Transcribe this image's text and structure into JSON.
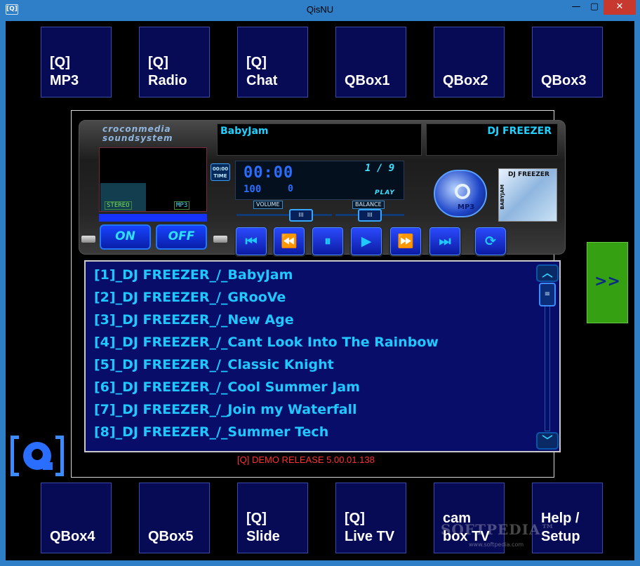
{
  "window": {
    "title": "QisNU",
    "icon_text": "[Q]",
    "minimize": "—",
    "maximize": "▢",
    "close": "✕"
  },
  "nav_top": [
    {
      "line1": "[Q]",
      "line2": "MP3"
    },
    {
      "line1": "[Q]",
      "line2": "Radio"
    },
    {
      "line1": "[Q]",
      "line2": "Chat"
    },
    {
      "line1": "",
      "line2": "QBox1"
    },
    {
      "line1": "",
      "line2": "QBox2"
    },
    {
      "line1": "",
      "line2": "QBox3"
    }
  ],
  "nav_bottom": [
    {
      "line1": "",
      "line2": "QBox4"
    },
    {
      "line1": "",
      "line2": "QBox5"
    },
    {
      "line1": "[Q]",
      "line2": "Slide"
    },
    {
      "line1": "[Q]",
      "line2": "Live TV"
    },
    {
      "line1": "cam",
      "line2": "box TV"
    },
    {
      "line1": "Help /",
      "line2": "Setup"
    }
  ],
  "player": {
    "brand_line1": "croconmedia",
    "brand_line2": "soundsystem",
    "song_title": "BabyJam",
    "artist": "DJ FREEZER",
    "time_badge_line1": "00:00",
    "time_badge_line2": "TIME",
    "time": "00:00",
    "track_count": "1 / 9",
    "volume_value": "100",
    "balance_value": "0",
    "state": "PLAY",
    "stereo_tag": "STEREO",
    "format_tag": "MP3",
    "volume_label": "VOLUME",
    "balance_label": "BALANCE",
    "knob_glyph": "III",
    "mp3_button_label": "MP3",
    "cover_title": "DJ FREEZER",
    "cover_side": "BABYJAM",
    "on_label": "ON",
    "off_label": "OFF",
    "buttons": {
      "first": "⏮",
      "rewind": "⏪",
      "pause": "⏸",
      "play": "▶",
      "forward": "⏩",
      "last": "⏭",
      "repeat": "⟳"
    }
  },
  "playlist": [
    "[1]_DJ FREEZER_/_BabyJam",
    "[2]_DJ FREEZER_/_GRooVe",
    "[3]_DJ FREEZER_/_New Age",
    "[4]_DJ FREEZER_/_Cant Look Into The Rainbow",
    "[5]_DJ FREEZER_/_Classic Knight",
    "[6]_DJ FREEZER_/_Cool Summer Jam",
    "[7]_DJ FREEZER_/_Join my Waterfall",
    "[8]_DJ FREEZER_/_Summer Tech"
  ],
  "scrollbar": {
    "up": "︿",
    "down": "﹀",
    "thumb": "≡"
  },
  "demo_release": "[Q] DEMO RELEASE 5.00.01.138",
  "expand_label": ">>",
  "watermark": "SOFTPEDIA™",
  "watermark_url": "www.softpedia.com",
  "icons": {
    "app": "q-bracket-icon",
    "logo": "q-logo-icon"
  }
}
